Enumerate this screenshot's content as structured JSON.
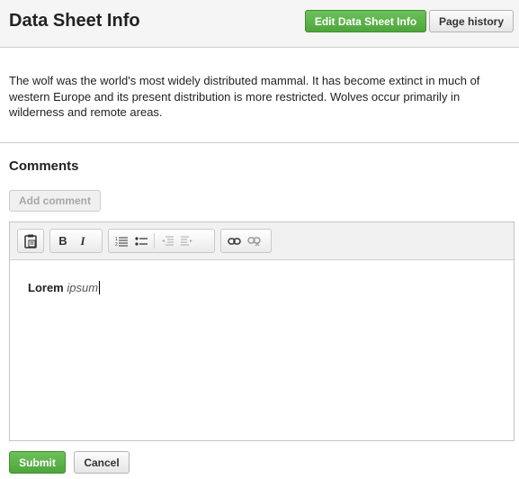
{
  "header": {
    "title": "Data Sheet Info",
    "edit_label": "Edit Data Sheet Info",
    "history_label": "Page history"
  },
  "description": "The wolf was the world's most widely distributed mammal. It has become extinct in much of western Europe and its present distribution is more restricted.  Wolves occur primarily in wilderness and remote areas.",
  "comments": {
    "title": "Comments",
    "add_label": "Add comment"
  },
  "editor": {
    "toolbar_icons": [
      "paste-icon",
      "bold-icon",
      "italic-icon",
      "numbered-list-icon",
      "bulleted-list-icon",
      "outdent-icon",
      "indent-icon",
      "link-icon",
      "unlink-icon"
    ],
    "bold_glyph": "B",
    "italic_glyph": "I",
    "content_bold": "Lorem",
    "content_italic": "ipsum"
  },
  "actions": {
    "submit_label": "Submit",
    "cancel_label": "Cancel"
  },
  "colors": {
    "accent_green": "#5cb34a",
    "header_bg": "#f5f5f5"
  }
}
